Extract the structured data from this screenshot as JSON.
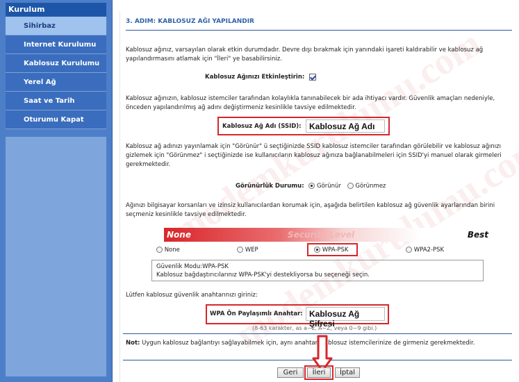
{
  "sidebar": {
    "title": "Kurulum",
    "items": [
      {
        "label": "Sihirbaz",
        "active": true
      },
      {
        "label": "Internet Kurulumu",
        "active": false
      },
      {
        "label": "Kablosuz Kurulumu",
        "active": false
      },
      {
        "label": "Yerel Ağ",
        "active": false
      },
      {
        "label": "Saat ve Tarih",
        "active": false
      },
      {
        "label": "Oturumu Kapat",
        "active": false
      }
    ]
  },
  "main": {
    "step_title": "3. ADIM: KABLOSUZ AĞI YAPILANDIR",
    "intro_text": "Kablosuz ağınız, varsayılan olarak etkin durumdadır. Devre dışı bırakmak için yanındaki işareti kaldırabilir ve kablosuz ağ yapılandırmasını atlamak için \"İleri\" ye basabilirsiniz.",
    "enable_label": "Kablosuz Ağınızı Etkinleştirin:",
    "enable_checked": true,
    "ssid_info": "Kablosuz ağınızın, kablosuz istemciler tarafından kolaylıkla tanınabilecek bir ada ihtiyacı vardır. Güvenlik amaçları nedeniyle, önceden yapılandırılmış ağ adını değiştirmeniz kesinlikle tavsiye edilmektedir.",
    "ssid_label": "Kablosuz Ağ Adı (SSID):",
    "ssid_value": "Kablosuz Ağ Adı",
    "visibility_info": "Kablosuz ağ adınızı yayınlamak için \"Görünür\" ü seçtiğinizde SSID kablosuz istemciler tarafından görülebilir ve kablosuz ağınızı gizlemek için \"Görünmez\" i seçtiğinizde ise kullanıcıların kablosuz ağınıza bağlanabilmeleri için SSID'yi manuel olarak girmeleri gerekmektedir.",
    "visibility_label": "Görünürlük Durumu:",
    "visibility_options": [
      "Görünür",
      "Görünmez"
    ],
    "visibility_selected": "Görünür",
    "security_info": "Ağınızı bilgisayar korsanları ve izinsiz kullanıcılardan korumak için, aşağıda belirtilen kablosuz ağ güvenlik ayarlarından birini seçmeniz kesinlikle tavsiye edilmektedir.",
    "security_bar": {
      "left": "None",
      "center": "Security Level",
      "right": "Best"
    },
    "security_options": [
      "None",
      "WEP",
      "WPA-PSK",
      "WPA2-PSK"
    ],
    "security_selected": "WPA-PSK",
    "security_mode_text": "Güvenlik Modu:WPA-PSK",
    "security_mode_desc": "Kablosuz bağdaştırıcılarınız WPA-PSK'yi destekliyorsa bu seçeneği seçin.",
    "key_prompt": "Lütfen kablosuz güvenlik anahtarınızı giriniz:",
    "psk_label": "WPA Ön Paylaşımlı Anahtar:",
    "psk_value": "Kablosuz Ağ Şifresi",
    "psk_hint": "(8-63 karakter, as a~z, A~Z, veya 0~9 gibi.)",
    "note_label": "Not:",
    "note_text": "Uygun kablosuz bağlantıyı sağlayabilmek için, aynı anahtarı kablosuz istemcilerinize de girmeniz gerekmektedir.",
    "buttons": {
      "back": "Geri",
      "next": "İleri",
      "cancel": "İptal"
    }
  },
  "colors": {
    "sidebar_bg": "#4d7fc9",
    "sidebar_title_bg": "#1d56a8",
    "title_blue": "#2f63aa",
    "highlight_red": "#d6262b"
  }
}
